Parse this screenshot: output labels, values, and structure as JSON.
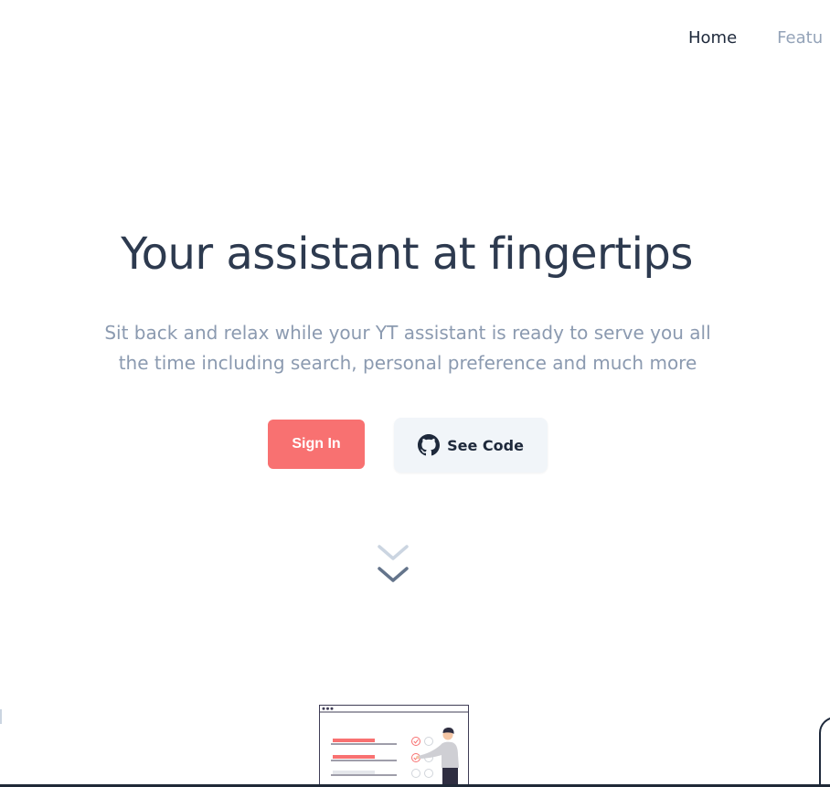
{
  "nav": {
    "items": [
      {
        "label": "Home",
        "active": true
      },
      {
        "label": "Featu",
        "active": false
      }
    ]
  },
  "hero": {
    "title": "Your assistant at fingertips",
    "subtitle_line1": "Sit back and relax while your YT assistant is ready to serve you all",
    "subtitle_line2": "the time including search, personal preference and much more"
  },
  "buttons": {
    "sign_in": "Sign In",
    "see_code": "See Code",
    "see_code_icon": "github-icon"
  },
  "scroll": {
    "icon": "double-chevron-down-icon"
  },
  "colors": {
    "accent": "#f87171",
    "heading": "#2d3a4f",
    "muted": "#8b9ab0",
    "nav_active": "#1e293b",
    "nav_inactive": "#94a3b8",
    "secondary_button_bg": "#f1f5f9"
  }
}
